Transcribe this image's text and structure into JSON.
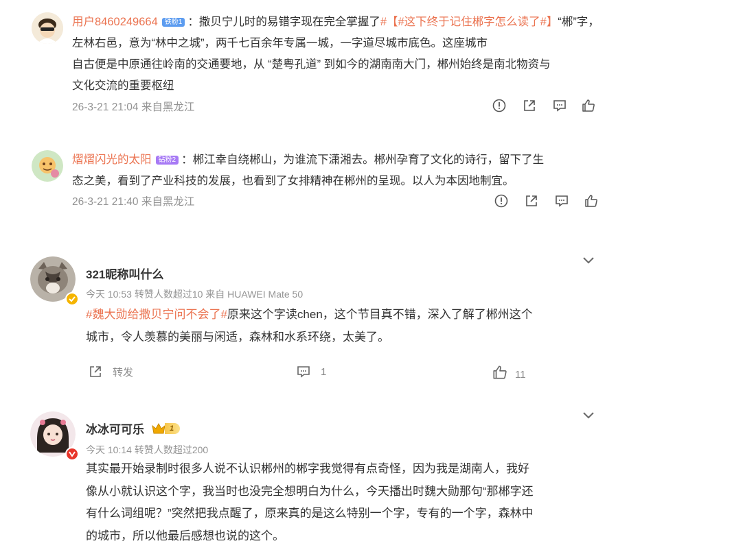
{
  "comments": [
    {
      "user": "用户8460249664",
      "badge": "铁粉1",
      "text_prefix": "：撒贝宁儿时的易错字现在完全掌握了",
      "hashtag": "#【#这下终于记住郴字怎么读了#】",
      "text_line1_rest": "“郴”字，左林右邑，意为“林中之城”，两千七百余年专属一城，一字道尽城市底色。这座城市",
      "text_line2": "自古便是中原通往岭南的交通要地，从 “楚粤孔道” 到如今的湖南南大门，郴州始终是南北物资与",
      "text_line3": "文化交流的重要枢纽",
      "time": "26-3-21 21:04 来自黑龙江"
    },
    {
      "user": "熠熠闪光的太阳",
      "badge": "钻粉2",
      "text_line1": "：郴江幸自绕郴山，为谁流下潇湘去。郴州孕育了文化的诗行，留下了生",
      "text_line2": "态之美，看到了产业科技的发展，也看到了女排精神在郴州的呈现。以人为本因地制宜。",
      "time": "26-3-21 21:40 来自黑龙江"
    }
  ],
  "posts": [
    {
      "user": "321昵称叫什么",
      "meta": "今天 10:53 转赞人数超过10  来自 HUAWEI Mate 50",
      "hashtag": "#魏大勋给撒贝宁问不会了#",
      "text_line1_rest": "原来这个字读chen，这个节目真不错，深入了解了郴州这个",
      "text_line2": "城市，令人羡慕的美丽与闲适，森林和水系环绕，太美了。",
      "repost_label": "转发",
      "comment_count": "1",
      "like_count": "11"
    },
    {
      "user": "冰冰可可乐",
      "level_badge": "1",
      "meta": "今天 10:14 转赞人数超过200",
      "text_line1": "其实最开始录制时很多人说不认识郴州的郴字我觉得有点奇怪，因为我是湖南人，我好",
      "text_line2": "像从小就认识这个字，我当时也没完全想明白为什么，今天播出时魏大勋那句“那郴字还",
      "text_line3": "有什么词组呢？”突然把我点醒了，原来真的是这么特别一个字，专有的一个字，森林中",
      "text_line4": "的城市，所以他最后感想也说的这个。"
    }
  ]
}
